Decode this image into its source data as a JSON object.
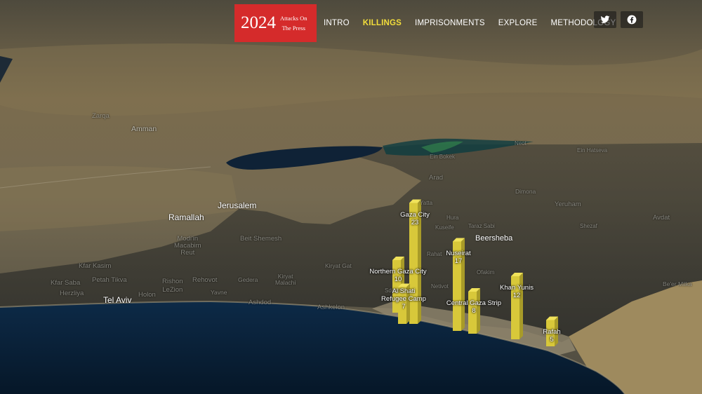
{
  "header": {
    "logo_year": "2024",
    "logo_line1": "Attacks On",
    "logo_line2": "The Press",
    "nav": [
      {
        "label": "INTRO",
        "active": false
      },
      {
        "label": "KILLINGS",
        "active": true
      },
      {
        "label": "IMPRISONMENTS",
        "active": false
      },
      {
        "label": "EXPLORE",
        "active": false
      },
      {
        "label": "METHODOLOGY",
        "active": false
      }
    ],
    "social": [
      "twitter-icon",
      "facebook-icon"
    ]
  },
  "colors": {
    "accent_red": "#d52b2b",
    "active_nav": "#f2dd3b",
    "bar_yellow": "#d8c83a"
  },
  "places": {
    "zarqa": "Zarqa",
    "amman": "Amman",
    "jerusalem": "Jerusalem",
    "ramallah": "Ramallah",
    "beit_shemesh": "Beit Shemesh",
    "modiin": "Modi'in\nMacabim\nReut",
    "kfar_kasim": "Kfar Kasim",
    "kfar_saba": "Kfar Saba",
    "petah_tikva": "Petah Tikva",
    "herzliya": "Herzliya",
    "tel_aviv": "Tel Aviv",
    "holon": "Holon",
    "rishon": "Rishon\nLeZion",
    "rehovot": "Rehovot",
    "yavne": "Yavne",
    "gedera": "Gedera",
    "kiryat_malachi": "Kiryat\nMalachi",
    "ashdod": "Ashdod",
    "ashkelon": "Ashkelon",
    "kiryat_gat": "Kiryat Gat",
    "beersheba": "Beersheba",
    "arad": "Arad",
    "dimona": "Dimona",
    "yeruham": "Yeruham",
    "avdat": "Avdat",
    "beer_milka": "Be'er Milka",
    "ofakim": "Ofakim",
    "netivot": "Netivot",
    "rahat": "Rahat",
    "sderot": "Sderot",
    "kuseife": "Kuseife",
    "hura": "Hura",
    "yatta": "Yatta",
    "ein_bokek": "Ein Bokek",
    "neot": "Neot",
    "ein_hatseva": "Ein Hatseva",
    "shezaf": "Shezaf",
    "taraz_sabi": "Taraz Sabi"
  },
  "bars": [
    {
      "name": "Gaza City",
      "value": 23
    },
    {
      "name": "Northern Gaza City",
      "value": 10
    },
    {
      "name": "Al Shati\nRefugee Camp",
      "value": 7
    },
    {
      "name": "Nuseirat",
      "value": 17
    },
    {
      "name": "Central Gaza Strip",
      "value": 8
    },
    {
      "name": "Khan Yunis",
      "value": 12
    },
    {
      "name": "Rafah",
      "value": 5
    }
  ]
}
